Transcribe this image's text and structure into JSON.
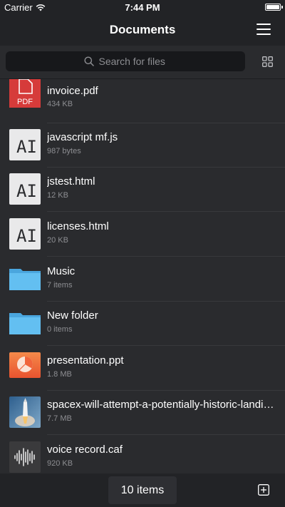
{
  "status_bar": {
    "carrier": "Carrier",
    "time": "7:44 PM",
    "battery_level": 1.0
  },
  "nav": {
    "title": "Documents",
    "menu_icon": "hamburger-menu-icon"
  },
  "search": {
    "placeholder": "Search for files",
    "value": "",
    "icon": "search-icon",
    "view_toggle_icon": "grid-view-icon"
  },
  "files": [
    {
      "name": "invoice.pdf",
      "meta": "434 KB",
      "icon": "pdf-file-icon",
      "badge": "PDF"
    },
    {
      "name": "javascript mf.js",
      "meta": "987 bytes",
      "icon": "text-file-icon",
      "badge": "AI"
    },
    {
      "name": "jstest.html",
      "meta": "12 KB",
      "icon": "text-file-icon",
      "badge": "AI"
    },
    {
      "name": "licenses.html",
      "meta": "20 KB",
      "icon": "text-file-icon",
      "badge": "AI"
    },
    {
      "name": "Music",
      "meta": "7 items",
      "icon": "folder-icon"
    },
    {
      "name": "New folder",
      "meta": "0 items",
      "icon": "folder-icon"
    },
    {
      "name": "presentation.ppt",
      "meta": "1.8 MB",
      "icon": "presentation-file-icon"
    },
    {
      "name": "spacex-will-attempt-a-potentially-historic-landing.jpg",
      "meta": "7.7 MB",
      "icon": "rocket-photo-thumbnail"
    },
    {
      "name": "voice record.caf",
      "meta": "920 KB",
      "icon": "audio-waveform-icon"
    }
  ],
  "footer": {
    "count_label": "10 items",
    "add_icon": "add-icon"
  },
  "colors": {
    "background": "#2a2b2e",
    "bars": "#222326",
    "search_field": "#17181b",
    "secondary_text": "#8d8e92",
    "folder": "#5bb8ee",
    "pdf_red": "#d63b3a",
    "ppt_orange": "#f0653b"
  }
}
